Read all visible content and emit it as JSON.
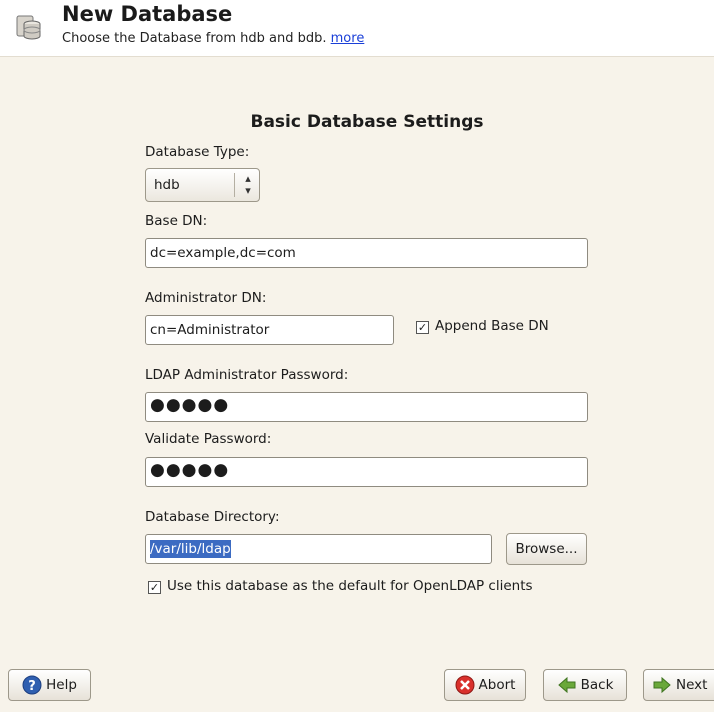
{
  "header": {
    "title": "New Database",
    "subtitle": "Choose the Database from hdb and bdb.",
    "more_link": "more",
    "icon": "database-icon"
  },
  "section_title": "Basic Database Settings",
  "database_type": {
    "label": "Database Type:",
    "value": "hdb"
  },
  "base_dn": {
    "label": "Base DN:",
    "value": "dc=example,dc=com"
  },
  "admin_dn": {
    "label": "Administrator DN:",
    "value": "cn=Administrator",
    "append_label": "Append Base DN",
    "append_checked": true
  },
  "ldap_password": {
    "label": "LDAP Administrator Password:",
    "masked": "●●●●●"
  },
  "validate_password": {
    "label": "Validate Password:",
    "masked": "●●●●●"
  },
  "db_directory": {
    "label": "Database Directory:",
    "value": "/var/lib/ldap",
    "browse_label": "Browse..."
  },
  "default_client": {
    "label": "Use this database as the default for OpenLDAP clients",
    "checked": true
  },
  "footer": {
    "help_label": "Help",
    "abort_label": "Abort",
    "back_label": "Back",
    "next_label": "Next"
  },
  "colors": {
    "background": "#f7f3ea",
    "selection": "#3c6bc2",
    "link": "#1a3fd8",
    "abort": "#d9302c",
    "arrow": "#6aa83a"
  }
}
